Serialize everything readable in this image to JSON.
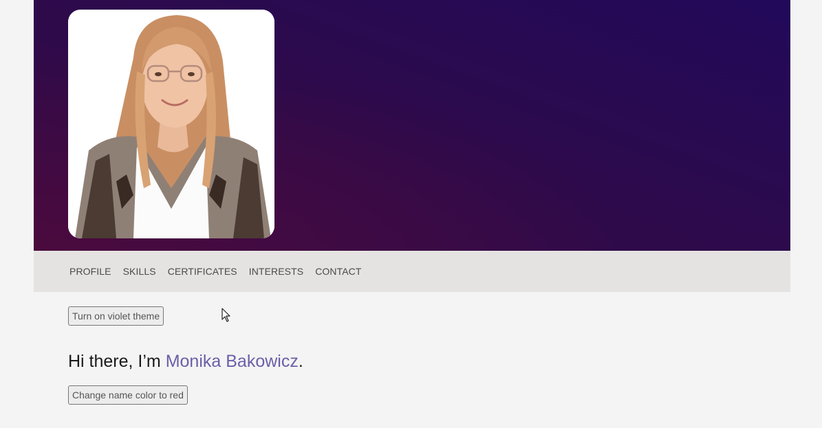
{
  "hero": {
    "photo_icon": "profile-photo"
  },
  "nav": {
    "items": [
      {
        "label": "PROFILE"
      },
      {
        "label": "SKILLS"
      },
      {
        "label": "CERTIFICATES"
      },
      {
        "label": "INTERESTS"
      },
      {
        "label": "CONTACT"
      }
    ]
  },
  "buttons": {
    "theme_label": "Turn on violet theme",
    "name_color_label": "Change name color to red"
  },
  "greeting": {
    "prefix": "Hi there, I’m ",
    "name": "Monika Bakowicz",
    "suffix": "."
  },
  "colors": {
    "hero_dark": "#2e0a4a",
    "nav_bg": "#e5e3e1",
    "name_accent": "#6b5fa8",
    "page_bg": "#f4f4f4"
  }
}
